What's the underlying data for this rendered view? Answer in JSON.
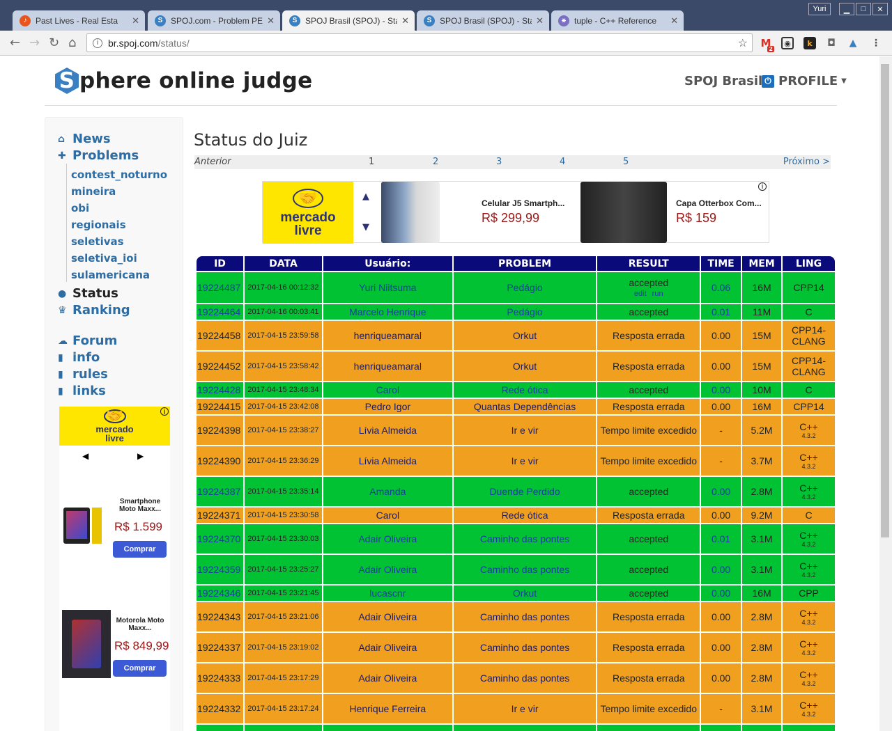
{
  "window": {
    "user": "Yuri"
  },
  "tabs": [
    {
      "title": "Past Lives - Real Esta",
      "color": "#e8541c",
      "glyph": "♪",
      "active": false
    },
    {
      "title": "SPOJ.com - Problem PE",
      "color": "#3a7fc1",
      "glyph": "S",
      "active": false
    },
    {
      "title": "SPOJ Brasil (SPOJ) - Stat",
      "color": "#3a7fc1",
      "glyph": "S",
      "active": true
    },
    {
      "title": "SPOJ Brasil (SPOJ) - Stat",
      "color": "#3a7fc1",
      "glyph": "S",
      "active": false
    },
    {
      "title": "tuple - C++ Reference",
      "color": "#7a6fc0",
      "glyph": "⚹",
      "active": false
    }
  ],
  "address": {
    "host": "br.spoj.com",
    "path": "/status/"
  },
  "extensions": {
    "gmail_count": "2"
  },
  "header": {
    "logo_letter": "S",
    "logo_rest": "phere online judge",
    "brand": "SPOJ Brasil",
    "profile": "PROFILE"
  },
  "sidebar": {
    "top": [
      {
        "label": "News",
        "icon": "home-icon",
        "glyph": "⌂"
      },
      {
        "label": "Problems",
        "icon": "puzzle-icon",
        "glyph": "✚"
      }
    ],
    "sub": [
      "contest_noturno",
      "mineira",
      "obi",
      "regionais",
      "seletivas",
      "seletiva_ioi",
      "sulamericana"
    ],
    "mid": [
      {
        "label": "Status",
        "icon": "circle-icon",
        "glyph": "●"
      },
      {
        "label": "Ranking",
        "icon": "trophy-icon",
        "glyph": "♛"
      }
    ],
    "bottom": [
      {
        "label": "Forum",
        "icon": "chat-icon",
        "glyph": "☁"
      },
      {
        "label": "info",
        "icon": "file-icon",
        "glyph": "▮"
      },
      {
        "label": "rules",
        "icon": "file-icon",
        "glyph": "▮"
      },
      {
        "label": "links",
        "icon": "file-icon",
        "glyph": "▮"
      }
    ]
  },
  "side_ad": {
    "brand_top": "mercado",
    "brand_bottom": "livre",
    "items": [
      {
        "name": "Smartphone Moto Maxx...",
        "price": "R$ 1.599",
        "button": "Comprar"
      },
      {
        "name": "Motorola Moto Maxx...",
        "price": "R$ 849,99",
        "button": "Comprar"
      }
    ]
  },
  "main": {
    "title": "Status do Juiz",
    "prev": "Anterior",
    "next": "Próximo >",
    "pages": [
      "1",
      "2",
      "3",
      "4",
      "5"
    ]
  },
  "top_ad": {
    "brand_top": "mercado",
    "brand_bottom": "livre",
    "items": [
      {
        "name": "Celular J5 Smartph...",
        "price": "R$ 299,99"
      },
      {
        "name": "Capa Otterbox Com...",
        "price": "R$ 159"
      }
    ]
  },
  "table": {
    "headers": [
      "ID",
      "DATA",
      "Usuário:",
      "PROBLEM",
      "RESULT",
      "TIME",
      "MEM",
      "LING"
    ],
    "rows": [
      {
        "c": "g",
        "id": "19224487",
        "date": "2017-04-16 00:12:32",
        "user": "Yuri Niitsuma",
        "problem": "Pedágio",
        "result": "accepted",
        "time": "0.06",
        "mem": "16M",
        "lang": "CPP14",
        "lang_ver": "",
        "extra": [
          "edit",
          "run"
        ],
        "h": 44
      },
      {
        "c": "g",
        "id": "19224464",
        "date": "2017-04-16 00:03:41",
        "user": "Marcelo Henrique",
        "problem": "Pedágio",
        "result": "accepted",
        "time": "0.01",
        "mem": "11M",
        "lang": "C",
        "lang_ver": "",
        "h": 22
      },
      {
        "c": "o",
        "id": "19224458",
        "date": "2017-04-15 23:59:58",
        "user": "henriqueamaral",
        "problem": "Orkut",
        "result": "Resposta errada",
        "time": "0.00",
        "mem": "15M",
        "lang": "CPP14-CLANG",
        "lang_ver": "",
        "h": 42
      },
      {
        "c": "o",
        "id": "19224452",
        "date": "2017-04-15 23:58:42",
        "user": "henriqueamaral",
        "problem": "Orkut",
        "result": "Resposta errada",
        "time": "0.00",
        "mem": "15M",
        "lang": "CPP14-CLANG",
        "lang_ver": "",
        "h": 42
      },
      {
        "c": "g",
        "id": "19224428",
        "date": "2017-04-15 23:48:34",
        "user": "Carol",
        "problem": "Rede ótica",
        "result": "accepted",
        "time": "0.00",
        "mem": "10M",
        "lang": "C",
        "lang_ver": "",
        "h": 22
      },
      {
        "c": "o",
        "id": "19224415",
        "date": "2017-04-15 23:42:08",
        "user": "Pedro Igor",
        "problem": "Quantas Dependências",
        "result": "Resposta errada",
        "time": "0.00",
        "mem": "16M",
        "lang": "CPP14",
        "lang_ver": "",
        "h": 22
      },
      {
        "c": "o",
        "id": "19224398",
        "date": "2017-04-15 23:38:27",
        "user": "Lívia Almeida",
        "problem": "Ir e vir",
        "result": "Tempo limite excedido",
        "time": "-",
        "mem": "5.2M",
        "lang": "C++",
        "lang_ver": "4.3.2",
        "h": 42
      },
      {
        "c": "o",
        "id": "19224390",
        "date": "2017-04-15 23:36:29",
        "user": "Lívia Almeida",
        "problem": "Ir e vir",
        "result": "Tempo limite excedido",
        "time": "-",
        "mem": "3.7M",
        "lang": "C++",
        "lang_ver": "4.3.2",
        "h": 42
      },
      {
        "c": "g",
        "id": "19224387",
        "date": "2017-04-15 23:35:14",
        "user": "Amanda",
        "problem": "Duende Perdido",
        "result": "accepted",
        "time": "0.00",
        "mem": "2.8M",
        "lang": "C++",
        "lang_ver": "4.3.2",
        "h": 42
      },
      {
        "c": "o",
        "id": "19224371",
        "date": "2017-04-15 23:30:58",
        "user": "Carol",
        "problem": "Rede ótica",
        "result": "Resposta errada",
        "time": "0.00",
        "mem": "9.2M",
        "lang": "C",
        "lang_ver": "",
        "h": 22
      },
      {
        "c": "g",
        "id": "19224370",
        "date": "2017-04-15 23:30:03",
        "user": "Adair Oliveira",
        "problem": "Caminho das pontes",
        "result": "accepted",
        "time": "0.01",
        "mem": "3.1M",
        "lang": "C++",
        "lang_ver": "4.3.2",
        "h": 42
      },
      {
        "c": "g",
        "id": "19224359",
        "date": "2017-04-15 23:25:27",
        "user": "Adair Oliveira",
        "problem": "Caminho das pontes",
        "result": "accepted",
        "time": "0.00",
        "mem": "3.1M",
        "lang": "C++",
        "lang_ver": "4.3.2",
        "h": 42
      },
      {
        "c": "g",
        "id": "19224346",
        "date": "2017-04-15 23:21:45",
        "user": "lucascnr",
        "problem": "Orkut",
        "result": "accepted",
        "time": "0.00",
        "mem": "16M",
        "lang": "CPP",
        "lang_ver": "",
        "h": 22
      },
      {
        "c": "o",
        "id": "19224343",
        "date": "2017-04-15 23:21:06",
        "user": "Adair Oliveira",
        "problem": "Caminho das pontes",
        "result": "Resposta errada",
        "time": "0.00",
        "mem": "2.8M",
        "lang": "C++",
        "lang_ver": "4.3.2",
        "h": 42
      },
      {
        "c": "o",
        "id": "19224337",
        "date": "2017-04-15 23:19:02",
        "user": "Adair Oliveira",
        "problem": "Caminho das pontes",
        "result": "Resposta errada",
        "time": "0.00",
        "mem": "2.8M",
        "lang": "C++",
        "lang_ver": "4.3.2",
        "h": 42
      },
      {
        "c": "o",
        "id": "19224333",
        "date": "2017-04-15 23:17:29",
        "user": "Adair Oliveira",
        "problem": "Caminho das pontes",
        "result": "Resposta errada",
        "time": "0.00",
        "mem": "2.8M",
        "lang": "C++",
        "lang_ver": "4.3.2",
        "h": 42
      },
      {
        "c": "o",
        "id": "19224332",
        "date": "2017-04-15 23:17:24",
        "user": "Henrique Ferreira",
        "problem": "Ir e vir",
        "result": "Tempo limite excedido",
        "time": "-",
        "mem": "3.1M",
        "lang": "C++",
        "lang_ver": "4.3.2",
        "h": 42
      },
      {
        "c": "g",
        "id": "",
        "date": "",
        "user": "",
        "problem": "",
        "result": "",
        "time": "",
        "mem": "",
        "lang": "",
        "lang_ver": "",
        "h": 22
      }
    ]
  }
}
